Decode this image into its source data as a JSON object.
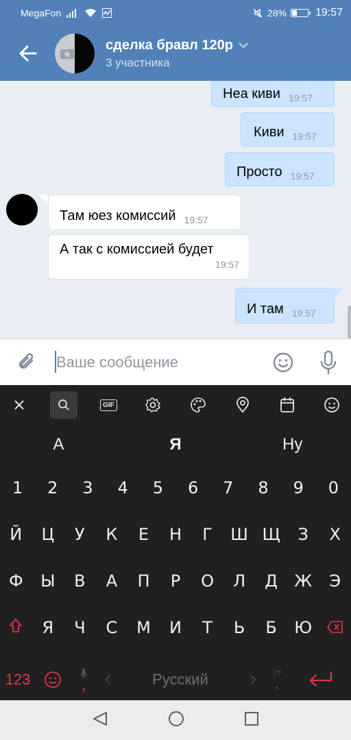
{
  "status_bar": {
    "carrier": "MegaFon",
    "battery": "28%",
    "battery_level": 0.28,
    "time": "19:57"
  },
  "header": {
    "title": "сделка бравл 120р",
    "subtitle": "3 участника",
    "back_icon": "arrow-left-icon",
    "dropdown_icon": "chevron-down-icon"
  },
  "messages": [
    {
      "direction": "out",
      "text": "Неа киви",
      "time": "19:57"
    },
    {
      "direction": "out",
      "text": "Киви",
      "time": "19:57"
    },
    {
      "direction": "out",
      "text": "Просто",
      "time": "19:57"
    },
    {
      "direction": "in",
      "text": "Там юез комиссий",
      "time": "19:57"
    },
    {
      "direction": "in",
      "text": "А так с комиссией будет",
      "time": "19:57"
    },
    {
      "direction": "out",
      "text": "И там",
      "time": "19:57"
    }
  ],
  "composer": {
    "placeholder": "Ваше сообщение"
  },
  "keyboard": {
    "toolbar": [
      "close-icon",
      "search-icon",
      "gif-icon",
      "settings-icon",
      "palette-icon",
      "location-icon",
      "calendar-icon",
      "emoji-icon"
    ],
    "gif_label": "GIF",
    "suggestions": [
      "А",
      "Я",
      "Ну"
    ],
    "digits": [
      "1",
      "2",
      "3",
      "4",
      "5",
      "6",
      "7",
      "8",
      "9",
      "0"
    ],
    "row1": [
      "Й",
      "Ц",
      "У",
      "К",
      "Е",
      "Н",
      "Г",
      "Ш",
      "Щ",
      "З",
      "Х"
    ],
    "row2": [
      "Ф",
      "Ы",
      "В",
      "А",
      "П",
      "Р",
      "О",
      "Л",
      "Д",
      "Ж",
      "Э"
    ],
    "row3": [
      "Я",
      "Ч",
      "С",
      "М",
      "И",
      "Т",
      "Ь",
      "Б",
      "Ю"
    ],
    "numbers_key": "123",
    "comma": ",",
    "language": "Русский",
    "punct_hint": ",!?",
    "period": ".",
    "accent_color": "#e6334a"
  },
  "colors": {
    "brand": "#5181b8",
    "outgoing_bubble": "#cce4ff",
    "incoming_bubble": "#ffffff",
    "keyboard_bg": "#202020"
  }
}
